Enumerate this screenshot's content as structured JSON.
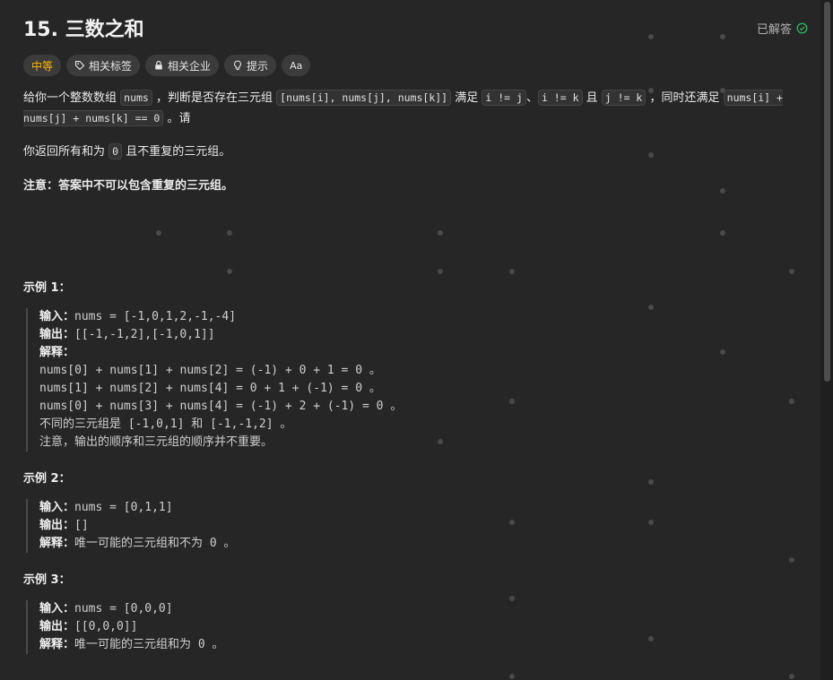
{
  "problem": {
    "title": "15. 三数之和",
    "status": "已解答"
  },
  "tags": {
    "difficulty": "中等",
    "topics": "相关标签",
    "companies": "相关企业",
    "hint": "提示",
    "font": "Aa"
  },
  "description": {
    "p1_a": "给你一个整数数组",
    "p1_code1": "nums",
    "p1_b": "，判断是否存在三元组",
    "p1_code2": "[nums[i], nums[j], nums[k]]",
    "p1_c": "满足",
    "p1_code3": "i != j",
    "p1_d": "、",
    "p1_code4": "i != k",
    "p1_e": "且",
    "p1_code5": "j != k",
    "p1_f": "，同时还满足",
    "p1_code6": "nums[i] + nums[j] + nums[k] == 0",
    "p1_g": "。请",
    "p2_a": "你返回所有和为",
    "p2_code": "0",
    "p2_b": "且不重复的三元组。",
    "p3_label": "注意：",
    "p3_text": "答案中不可以包含重复的三元组。"
  },
  "examples": [
    {
      "title": "示例 1：",
      "input_label": "输入：",
      "input": "nums = [-1,0,1,2,-1,-4]",
      "output_label": "输出：",
      "output": "[[-1,-1,2],[-1,0,1]]",
      "explain_label": "解释：",
      "lines": [
        "nums[0] + nums[1] + nums[2] = (-1) + 0 + 1 = 0 。",
        "nums[1] + nums[2] + nums[4] = 0 + 1 + (-1) = 0 。",
        "nums[0] + nums[3] + nums[4] = (-1) + 2 + (-1) = 0 。"
      ],
      "line4_a": "不同的三元组是",
      "line4_b": " [-1,0,1] ",
      "line4_c": "和",
      "line4_d": " [-1,-1,2] 。",
      "line5": "注意，输出的顺序和三元组的顺序并不重要。"
    },
    {
      "title": "示例 2：",
      "input_label": "输入：",
      "input": "nums = [0,1,1]",
      "output_label": "输出：",
      "output": "[]",
      "explain_label": "解释：",
      "explain_a": "唯一可能的三元组和不为",
      "explain_b": " 0 。"
    },
    {
      "title": "示例 3：",
      "input_label": "输入：",
      "input": "nums = [0,0,0]",
      "output_label": "输出：",
      "output": "[[0,0,0]]",
      "explain_label": "解释：",
      "explain_a": "唯一可能的三元组和为",
      "explain_b": " 0 。"
    }
  ],
  "colors": {
    "background": "#262626",
    "difficulty": "#ffb800",
    "solved_check": "#2cbb5d"
  }
}
